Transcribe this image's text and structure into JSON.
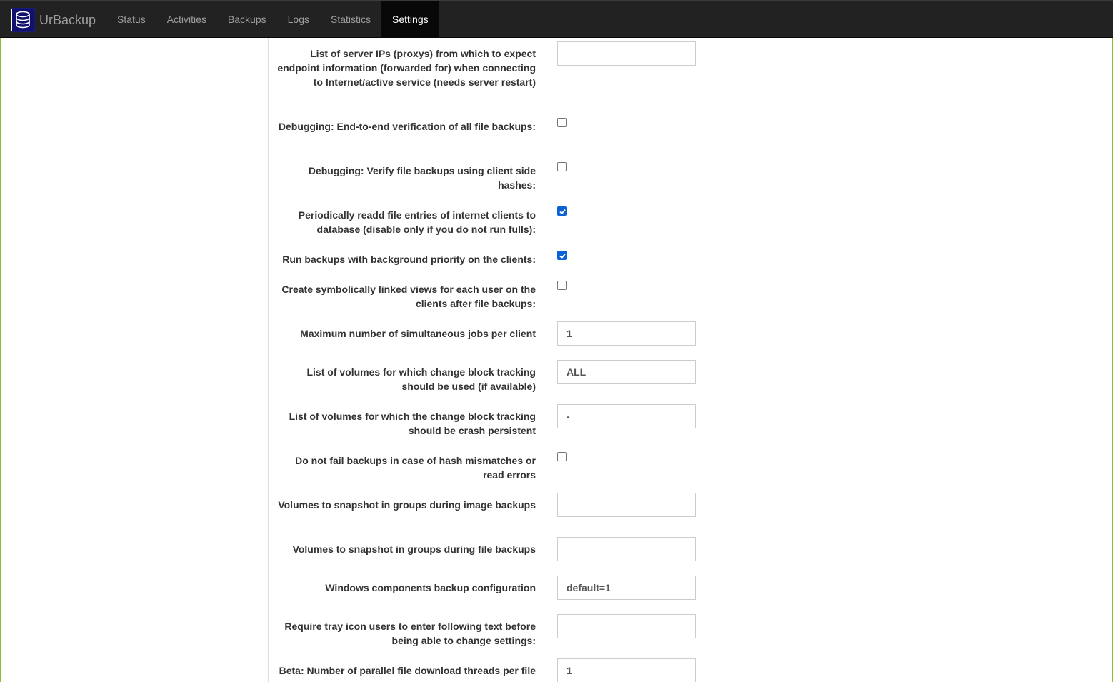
{
  "app": {
    "brand": "UrBackup",
    "accent_color": "#86bd3b",
    "logo_icon": "database-icon"
  },
  "nav": {
    "items": [
      {
        "label": "Status",
        "active": false
      },
      {
        "label": "Activities",
        "active": false
      },
      {
        "label": "Backups",
        "active": false
      },
      {
        "label": "Logs",
        "active": false
      },
      {
        "label": "Statistics",
        "active": false
      },
      {
        "label": "Settings",
        "active": true
      }
    ]
  },
  "settings": {
    "proxy_ips": {
      "label": "List of server IPs (proxys) from which to expect endpoint information (forwarded for) when connecting to Internet/active service (needs server restart)",
      "value": ""
    },
    "e2e_verification": {
      "label": "Debugging: End-to-end verification of all file backups:",
      "checked": false
    },
    "verify_client_hashes": {
      "label": "Debugging: Verify file backups using client side hashes:",
      "checked": false
    },
    "readd_file_entries": {
      "label": "Periodically readd file entries of internet clients to database (disable only if you do not run fulls):",
      "checked": true
    },
    "background_priority": {
      "label": "Run backups with background priority on the clients:",
      "checked": true
    },
    "symlinked_views": {
      "label": "Create symbolically linked views for each user on the clients after file backups:",
      "checked": false
    },
    "max_jobs": {
      "label": "Maximum number of simultaneous jobs per client",
      "value": "1"
    },
    "cbt_volumes": {
      "label": "List of volumes for which change block tracking should be used (if available)",
      "value": "ALL"
    },
    "cbt_crash_persistent": {
      "label": "List of volumes for which the change block tracking should be crash persistent",
      "value": "-"
    },
    "ignore_hash_mismatch": {
      "label": "Do not fail backups in case of hash mismatches or read errors",
      "checked": false
    },
    "snapshot_groups_image": {
      "label": "Volumes to snapshot in groups during image backups",
      "value": ""
    },
    "snapshot_groups_file": {
      "label": "Volumes to snapshot in groups during file backups",
      "value": ""
    },
    "vss_components": {
      "label": "Windows components backup configuration",
      "value": "default=1"
    },
    "tray_password": {
      "label": "Require tray icon users to enter following text before being able to change settings:",
      "value": ""
    },
    "parallel_threads": {
      "label": "Beta: Number of parallel file download threads per file",
      "value": "1"
    }
  }
}
